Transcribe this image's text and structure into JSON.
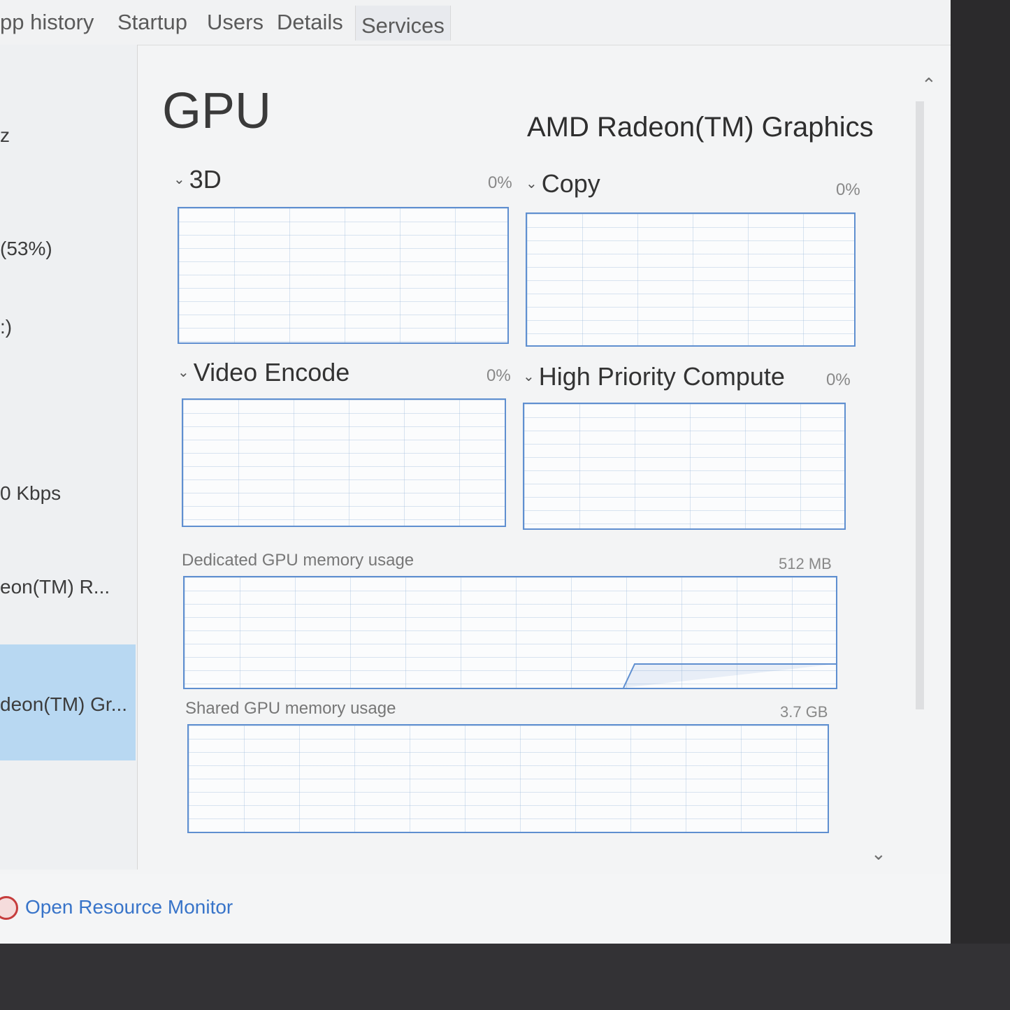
{
  "tabs": [
    "pp history",
    "Startup",
    "Users",
    "Details",
    "Services"
  ],
  "sidebar": {
    "items": [
      "z",
      "(53%)",
      ":)",
      "0 Kbps",
      "eon(TM) R...",
      "deon(TM) Gr..."
    ]
  },
  "gpu": {
    "title": "GPU",
    "adapter_name": "AMD Radeon(TM) Graphics",
    "engines": [
      {
        "label": "3D",
        "percent": "0%"
      },
      {
        "label": "Copy",
        "percent": "0%"
      },
      {
        "label": "Video Encode",
        "percent": "0%"
      },
      {
        "label": "High Priority Compute",
        "percent": "0%"
      }
    ],
    "dedicated_memory": {
      "label": "Dedicated GPU memory usage",
      "value": "512 MB"
    },
    "shared_memory": {
      "label": "Shared GPU memory usage",
      "value": "3.7 GB"
    }
  },
  "footer": {
    "open_resource_monitor": "Open Resource Monitor"
  },
  "icons": {
    "scroll_up": "chevron-up-icon",
    "scroll_down": "chevron-down-icon",
    "expand": "chevron-down-icon",
    "resource_monitor": "resource-monitor-icon"
  },
  "colors": {
    "graph_border": "#5f8fd0",
    "selected_sidebar": "#b8d8f2",
    "link": "#3874c9"
  }
}
